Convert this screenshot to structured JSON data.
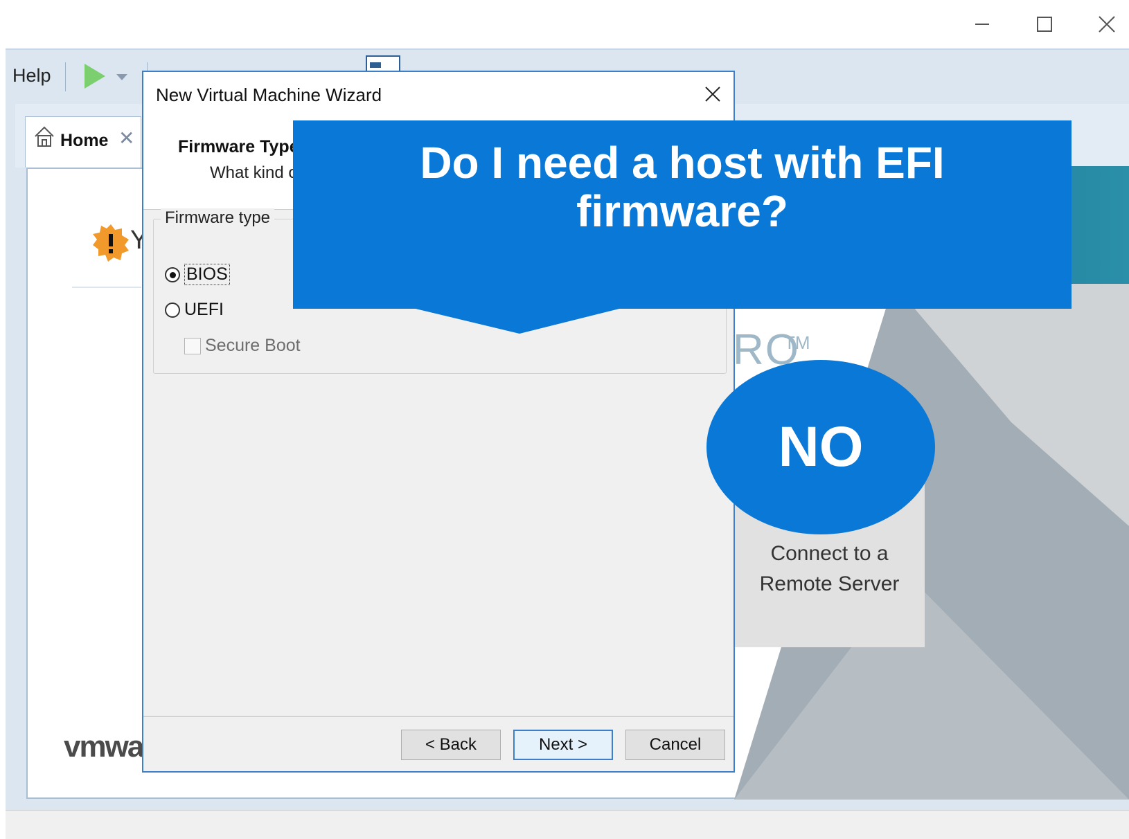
{
  "window": {
    "controls": {
      "minimize": "minimize-icon",
      "maximize": "maximize-icon",
      "close": "close-icon"
    }
  },
  "toolbar": {
    "help_label": "Help",
    "icons": [
      "play-icon",
      "dropdown-arrow-icon",
      "suspend-icon",
      "snapshot-icon",
      "snapshot-revert-icon",
      "snapshot-manager-icon",
      "sidebar-view-icon",
      "console-view-icon",
      "fullscreen-icon",
      "unity-icon",
      "library-icon"
    ]
  },
  "tabs": [
    {
      "label": "Home",
      "icon": "home-icon",
      "close_icon": "close-icon"
    }
  ],
  "home": {
    "warning_text": "Y",
    "brand_partial": "vmwa",
    "pro_partial": "RO",
    "pro_tm": "TM",
    "remote_server_label_line1": "Connect to a",
    "remote_server_label_line2": "Remote Server"
  },
  "dialog": {
    "title": "New Virtual Machine Wizard",
    "header_title": "Firmware Type",
    "header_subtitle": "What kind of",
    "group_label": "Firmware type",
    "options": [
      {
        "label": "BIOS",
        "selected": true
      },
      {
        "label": "UEFI",
        "selected": false
      }
    ],
    "secure_boot_label": "Secure Boot",
    "secure_boot_checked": false,
    "secure_boot_enabled": false,
    "buttons": {
      "back": "< Back",
      "next": "Next >",
      "cancel": "Cancel"
    }
  },
  "overlay": {
    "question_line1": "Do I need a host with EFI",
    "question_line2": "firmware?",
    "answer": "NO",
    "color": "#0a78d6"
  }
}
